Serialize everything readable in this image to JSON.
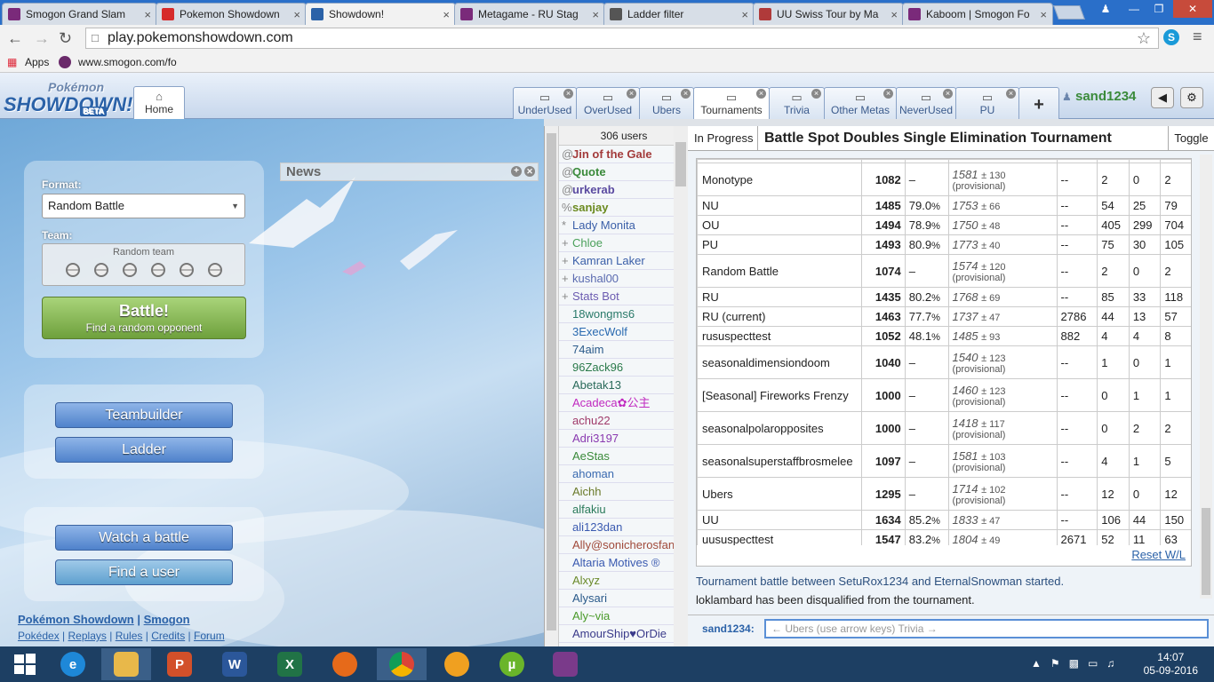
{
  "browser": {
    "tabs": [
      {
        "title": "Smogon Grand Slam",
        "favicon_color": "#7a2a7a"
      },
      {
        "title": "Pokemon Showdown",
        "favicon_color": "#d62b2b"
      },
      {
        "title": "Showdown!",
        "favicon_color": "#2b62a8"
      },
      {
        "title": "Metagame - RU Stag",
        "favicon_color": "#7a2a7a"
      },
      {
        "title": "Ladder filter",
        "favicon_color": "#555555"
      },
      {
        "title": "UU Swiss Tour by Ma",
        "favicon_color": "#b03a3a"
      },
      {
        "title": "Kaboom | Smogon Fo",
        "favicon_color": "#7a2a7a"
      }
    ],
    "close_glyph": "×",
    "url": "play.pokemonshowdown.com",
    "bookmarks": {
      "apps_label": "Apps",
      "item": "www.smogon.com/fo"
    }
  },
  "header": {
    "logo_top": "Pokémon",
    "logo_main": "SHOWDOWN!",
    "logo_badge": "BETA",
    "home_label": "Home",
    "room_tabs": [
      {
        "label": "UnderUsed"
      },
      {
        "label": "OverUsed"
      },
      {
        "label": "Ubers"
      },
      {
        "label": "Tournaments"
      },
      {
        "label": "Trivia"
      },
      {
        "label": "Other Metas"
      },
      {
        "label": "NeverUsed"
      },
      {
        "label": "PU"
      }
    ],
    "add_glyph": "+",
    "username": "sand1234"
  },
  "left": {
    "format_label": "Format:",
    "format_value": "Random Battle",
    "team_label": "Team:",
    "team_value": "Random team",
    "battle_title": "Battle!",
    "battle_sub": "Find a random opponent",
    "teambuilder": "Teambuilder",
    "ladder": "Ladder",
    "watch": "Watch a battle",
    "find_user": "Find a user",
    "news_title": "News",
    "footer1": [
      "Pokémon Showdown",
      "Smogon"
    ],
    "footer2": [
      "Pokédex",
      "Replays",
      "Rules",
      "Credits",
      "Forum"
    ],
    "separator": "|"
  },
  "userlist": {
    "count_label": "306 users",
    "users": [
      {
        "rank": "@",
        "name": "Jin of the Gale",
        "color": "#a33b3b",
        "bold": true
      },
      {
        "rank": "@",
        "name": "Quote",
        "color": "#3a8a3a",
        "bold": true
      },
      {
        "rank": "@",
        "name": "urkerab",
        "color": "#5a4aa0",
        "bold": true
      },
      {
        "rank": "%",
        "name": "sanjay",
        "color": "#6b8a1f",
        "bold": true
      },
      {
        "rank": "*",
        "name": "Lady Monita",
        "color": "#3a5fa8",
        "bold": false
      },
      {
        "rank": "+",
        "name": "Chloe",
        "color": "#4aa05a",
        "bold": false
      },
      {
        "rank": "+",
        "name": "Kamran Laker",
        "color": "#3a5fa8",
        "bold": false
      },
      {
        "rank": "+",
        "name": "kushal00",
        "color": "#5a6ab0",
        "bold": false
      },
      {
        "rank": "+",
        "name": "Stats Bot",
        "color": "#6a5ab0",
        "bold": false
      },
      {
        "rank": "",
        "name": "18wongms6",
        "color": "#2a7a6a",
        "bold": false
      },
      {
        "rank": "",
        "name": "3ExecWolf",
        "color": "#2a6ab0",
        "bold": false
      },
      {
        "rank": "",
        "name": "74aim",
        "color": "#2a5a8a",
        "bold": false
      },
      {
        "rank": "",
        "name": "96Zack96",
        "color": "#2a7a4a",
        "bold": false
      },
      {
        "rank": "",
        "name": "Abetak13",
        "color": "#2a6a5a",
        "bold": false
      },
      {
        "rank": "",
        "name": "Acadeca✿公主",
        "color": "#c02ac0",
        "bold": false
      },
      {
        "rank": "",
        "name": "achu22",
        "color": "#a03a6a",
        "bold": false
      },
      {
        "rank": "",
        "name": "Adri3197",
        "color": "#8a3ab0",
        "bold": false
      },
      {
        "rank": "",
        "name": "AeStas",
        "color": "#3a8a3a",
        "bold": false
      },
      {
        "rank": "",
        "name": "ahoman",
        "color": "#3a6ab0",
        "bold": false
      },
      {
        "rank": "",
        "name": "Aichh",
        "color": "#6a7a2a",
        "bold": false
      },
      {
        "rank": "",
        "name": "alfakiu",
        "color": "#2a7a5a",
        "bold": false
      },
      {
        "rank": "",
        "name": "ali123dan",
        "color": "#3a5ab0",
        "bold": false
      },
      {
        "rank": "",
        "name": "Ally@sonicherosfan",
        "color": "#a04a3a",
        "bold": false
      },
      {
        "rank": "",
        "name": "Altaria Motives ®",
        "color": "#3a5ab0",
        "bold": false
      },
      {
        "rank": "",
        "name": "Alxyz",
        "color": "#6a8a2a",
        "bold": false
      },
      {
        "rank": "",
        "name": "Alysari",
        "color": "#2a5a8a",
        "bold": false
      },
      {
        "rank": "",
        "name": "Aly~via",
        "color": "#4a9a2a",
        "bold": false
      },
      {
        "rank": "",
        "name": "AmourShip♥OrDie",
        "color": "#3a3a8a",
        "bold": false
      }
    ]
  },
  "tournament": {
    "status": "In Progress",
    "title": "Battle Spot Doubles Single Elimination Tournament",
    "toggle": "Toggle",
    "ladder_rows": [
      {
        "format": "Monotype",
        "elo": "1082",
        "gxe": "–",
        "gxe_pct": "",
        "glicko": "1581",
        "dev": "± 130",
        "prov": "(provisional)",
        "coil": "--",
        "w": "2",
        "l": "0",
        "t": "2"
      },
      {
        "format": "NU",
        "elo": "1485",
        "gxe": "79.0",
        "gxe_pct": "%",
        "glicko": "1753",
        "dev": "± 66",
        "prov": "",
        "coil": "--",
        "w": "54",
        "l": "25",
        "t": "79"
      },
      {
        "format": "OU",
        "elo": "1494",
        "gxe": "78.9",
        "gxe_pct": "%",
        "glicko": "1750",
        "dev": "± 48",
        "prov": "",
        "coil": "--",
        "w": "405",
        "l": "299",
        "t": "704"
      },
      {
        "format": "PU",
        "elo": "1493",
        "gxe": "80.9",
        "gxe_pct": "%",
        "glicko": "1773",
        "dev": "± 40",
        "prov": "",
        "coil": "--",
        "w": "75",
        "l": "30",
        "t": "105"
      },
      {
        "format": "Random Battle",
        "elo": "1074",
        "gxe": "–",
        "gxe_pct": "",
        "glicko": "1574",
        "dev": "± 120",
        "prov": "(provisional)",
        "coil": "--",
        "w": "2",
        "l": "0",
        "t": "2"
      },
      {
        "format": "RU",
        "elo": "1435",
        "gxe": "80.2",
        "gxe_pct": "%",
        "glicko": "1768",
        "dev": "± 69",
        "prov": "",
        "coil": "--",
        "w": "85",
        "l": "33",
        "t": "118"
      },
      {
        "format": "RU (current)",
        "elo": "1463",
        "gxe": "77.7",
        "gxe_pct": "%",
        "glicko": "1737",
        "dev": "± 47",
        "prov": "",
        "coil": "2786",
        "w": "44",
        "l": "13",
        "t": "57"
      },
      {
        "format": "rususpecttest",
        "elo": "1052",
        "gxe": "48.1",
        "gxe_pct": "%",
        "glicko": "1485",
        "dev": "± 93",
        "prov": "",
        "coil": "882",
        "w": "4",
        "l": "4",
        "t": "8"
      },
      {
        "format": "seasonaldimensiondoom",
        "elo": "1040",
        "gxe": "–",
        "gxe_pct": "",
        "glicko": "1540",
        "dev": "± 123",
        "prov": "(provisional)",
        "coil": "--",
        "w": "1",
        "l": "0",
        "t": "1"
      },
      {
        "format": "[Seasonal] Fireworks Frenzy",
        "elo": "1000",
        "gxe": "–",
        "gxe_pct": "",
        "glicko": "1460",
        "dev": "± 123",
        "prov": "(provisional)",
        "coil": "--",
        "w": "0",
        "l": "1",
        "t": "1"
      },
      {
        "format": "seasonalpolaropposites",
        "elo": "1000",
        "gxe": "–",
        "gxe_pct": "",
        "glicko": "1418",
        "dev": "± 117",
        "prov": "(provisional)",
        "coil": "--",
        "w": "0",
        "l": "2",
        "t": "2"
      },
      {
        "format": "seasonalsuperstaffbrosmelee",
        "elo": "1097",
        "gxe": "–",
        "gxe_pct": "",
        "glicko": "1581",
        "dev": "± 103",
        "prov": "(provisional)",
        "coil": "--",
        "w": "4",
        "l": "1",
        "t": "5"
      },
      {
        "format": "Ubers",
        "elo": "1295",
        "gxe": "–",
        "gxe_pct": "",
        "glicko": "1714",
        "dev": "± 102",
        "prov": "(provisional)",
        "coil": "--",
        "w": "12",
        "l": "0",
        "t": "12"
      },
      {
        "format": "UU",
        "elo": "1634",
        "gxe": "85.2",
        "gxe_pct": "%",
        "glicko": "1833",
        "dev": "± 47",
        "prov": "",
        "coil": "--",
        "w": "106",
        "l": "44",
        "t": "150"
      },
      {
        "format": "uususpecttest",
        "elo": "1547",
        "gxe": "83.2",
        "gxe_pct": "%",
        "glicko": "1804",
        "dev": "± 49",
        "prov": "",
        "coil": "2671",
        "w": "52",
        "l": "11",
        "t": "63"
      }
    ],
    "reset_wl": "Reset W/L",
    "messages": [
      "Tournament battle between SetuRox1234 and EternalSnowman started.",
      "loklambard has been disqualified from the tournament."
    ],
    "chat_user": "sand1234:",
    "chat_placeholder": "← Ubers (use arrow keys) Trivia →"
  },
  "taskbar": {
    "time": "14:07",
    "date": "05-09-2016"
  }
}
